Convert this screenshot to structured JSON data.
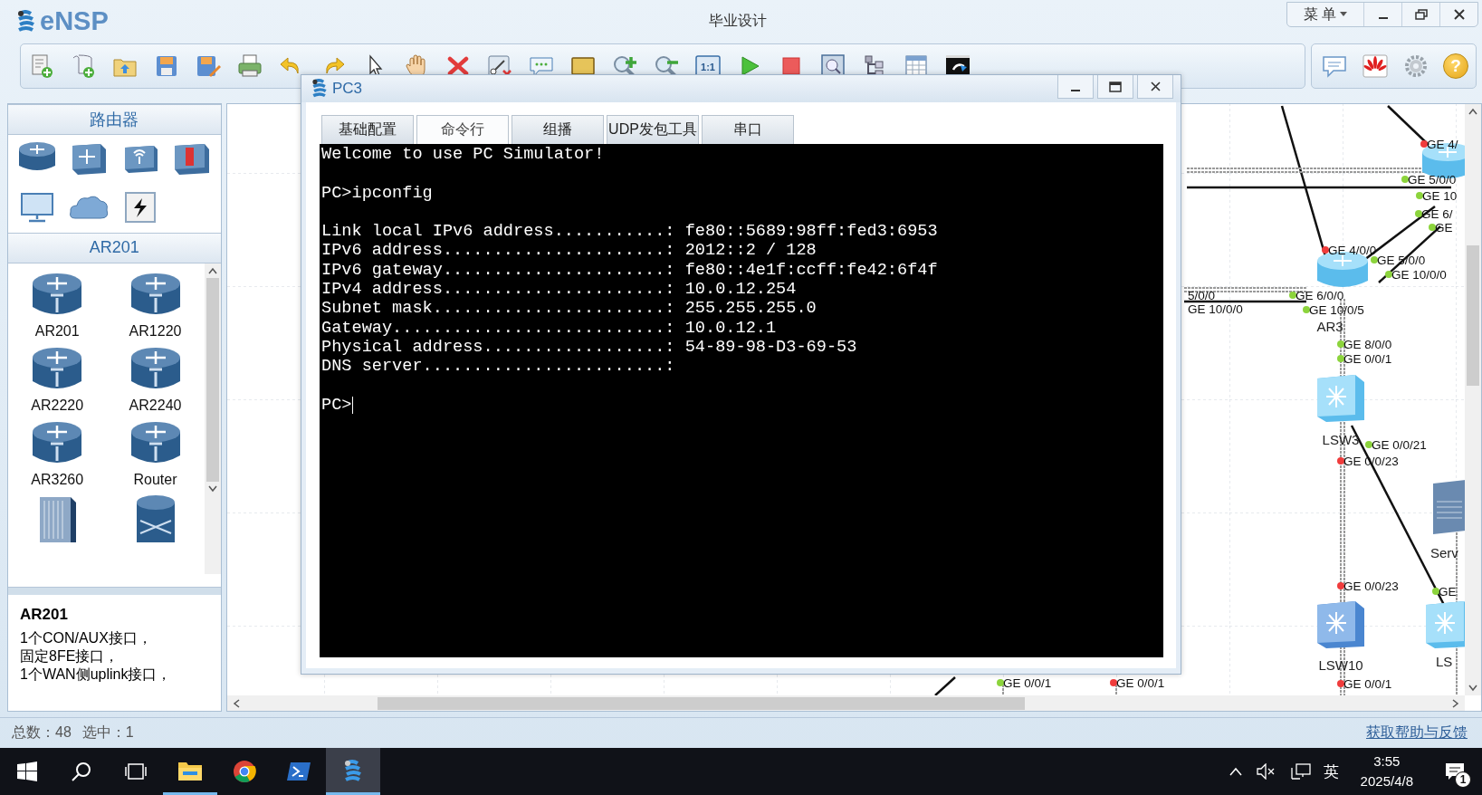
{
  "window": {
    "app_name": "eNSP",
    "title": "毕业设计",
    "menu": "菜 单"
  },
  "toolbar": {
    "fit_label": "1:1",
    "help_label": "?"
  },
  "sidebar": {
    "category_header": "路由器",
    "model_header": "AR201",
    "models": [
      {
        "kind": "router",
        "label": "AR201"
      },
      {
        "kind": "router",
        "label": "AR1220"
      },
      {
        "kind": "router",
        "label": "AR2220"
      },
      {
        "kind": "router",
        "label": "AR2240"
      },
      {
        "kind": "router",
        "label": "AR3260"
      },
      {
        "kind": "router",
        "label": "Router"
      },
      {
        "kind": "chassis"
      },
      {
        "kind": "core"
      }
    ],
    "details": {
      "title": "AR201",
      "lines": [
        "1个CON/AUX接口，",
        "固定8FE接口，",
        "1个WAN侧uplink接口，"
      ]
    }
  },
  "canvas": {
    "devices": [
      {
        "kind": "router"
      },
      {
        "kind": "router",
        "name": "AR3"
      },
      {
        "kind": "switch",
        "name": "LSW3"
      },
      {
        "kind": "server",
        "name": "Serv"
      },
      {
        "kind": "switch",
        "name": "LSW10"
      },
      {
        "kind": "switch",
        "name": "LS"
      }
    ],
    "port_labels": [
      {
        "text": "GE 4/",
        "color": "#f03c3c"
      },
      {
        "text": "GE 5/0/0",
        "color": "#8cd43c"
      },
      {
        "text": "GE 10",
        "color": "#8cd43c"
      },
      {
        "text": "GE 6/",
        "color": "#8cd43c"
      },
      {
        "text": "GE",
        "color": "#8cd43c"
      },
      {
        "text": "GE 4/0/0",
        "color": "#f03c3c"
      },
      {
        "text": "GE 5/0/0",
        "color": "#8cd43c"
      },
      {
        "text": "GE 10/0/0",
        "color": "#8cd43c"
      },
      {
        "text": "5/0/0"
      },
      {
        "text": "GE 10/0/0"
      },
      {
        "text": "GE 6/0/0",
        "color": "#8cd43c"
      },
      {
        "text": "GE 10/0/5",
        "color": "#8cd43c"
      },
      {
        "text": "GE 8/0/0",
        "color": "#8cd43c"
      },
      {
        "text": "GE 0/0/1",
        "color": "#8cd43c"
      },
      {
        "text": "GE 0/0/21",
        "color": "#8cd43c"
      },
      {
        "text": "GE 0/0/23",
        "color": "#f03c3c"
      },
      {
        "text": "GE 0/0/23",
        "color": "#f03c3c"
      },
      {
        "text": "GE",
        "color": "#8cd43c"
      },
      {
        "text": "GE 0/0/1",
        "color": "#8cd43c"
      },
      {
        "text": "GE 0/0/1",
        "color": "#f03c3c"
      },
      {
        "text": "GE 0/0/1",
        "color": "#f03c3c"
      }
    ]
  },
  "dialog": {
    "title": "PC3",
    "tabs": [
      {
        "label": "基础配置",
        "selected": false
      },
      {
        "label": "命令行",
        "selected": true
      },
      {
        "label": "组播",
        "selected": false
      },
      {
        "label": "UDP发包工具",
        "selected": false
      },
      {
        "label": "串口",
        "selected": false
      }
    ],
    "terminal": {
      "blocks": [
        [
          "Welcome to use PC Simulator!"
        ],
        [
          "PC>ipconfig"
        ],
        [
          "Link local IPv6 address...........: fe80::5689:98ff:fed3:6953",
          "IPv6 address......................: 2012::2 / 128",
          "IPv6 gateway......................: fe80::4e1f:ccff:fe42:6f4f",
          "IPv4 address......................: 10.0.12.254",
          "Subnet mask.......................: 255.255.255.0",
          "Gateway...........................: 10.0.12.1",
          "Physical address..................: 54-89-98-D3-69-53",
          "DNS server........................:"
        ],
        [
          "PC>"
        ]
      ]
    }
  },
  "status_bar": {
    "total": "总数：48",
    "selected": "选中：1",
    "help_link": "获取帮助与反馈"
  },
  "taskbar": {
    "apps": [
      {
        "kind": "files",
        "running": true,
        "selected": false
      },
      {
        "kind": "chrome",
        "running": false,
        "selected": false
      },
      {
        "kind": "powershell",
        "running": false,
        "selected": false
      },
      {
        "kind": "ensp",
        "running": true,
        "selected": true
      }
    ],
    "ime": "英",
    "time": "3:55",
    "date": "2025/4/8",
    "notifications": "1"
  }
}
